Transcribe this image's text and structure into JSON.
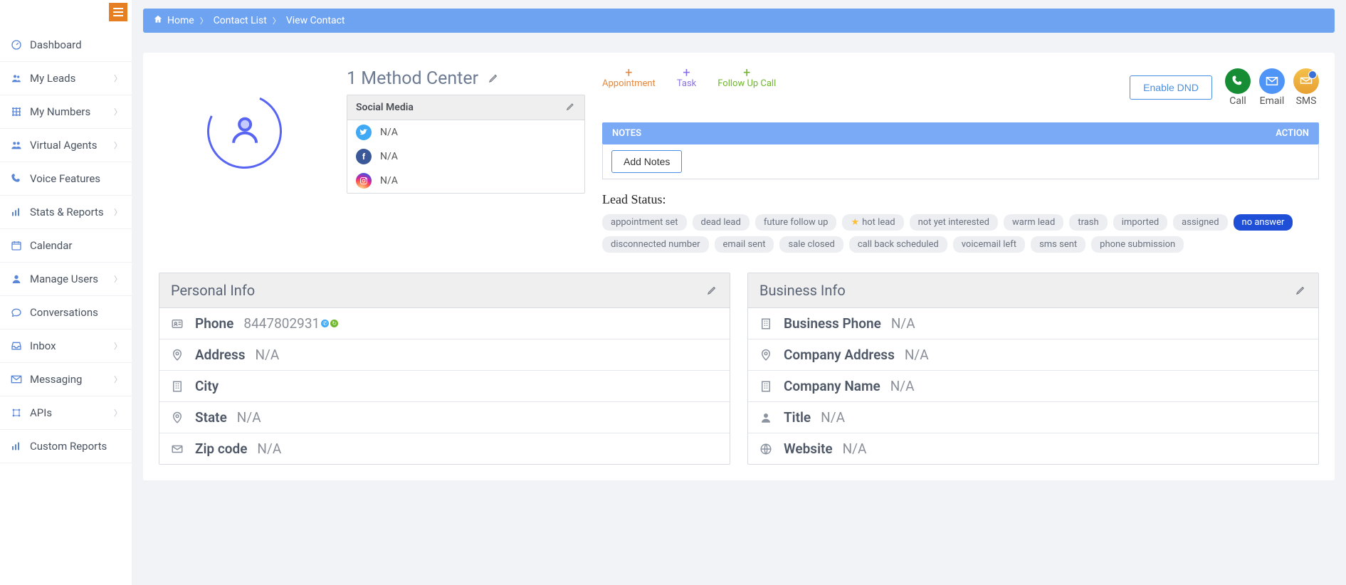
{
  "sidebar": {
    "items": [
      {
        "icon": "dashboard",
        "label": "Dashboard",
        "chevron": false
      },
      {
        "icon": "users",
        "label": "My Leads",
        "chevron": true
      },
      {
        "icon": "grid",
        "label": "My Numbers",
        "chevron": true
      },
      {
        "icon": "agents",
        "label": "Virtual Agents",
        "chevron": true
      },
      {
        "icon": "phone",
        "label": "Voice Features",
        "chevron": false
      },
      {
        "icon": "bars",
        "label": "Stats & Reports",
        "chevron": true
      },
      {
        "icon": "calendar",
        "label": "Calendar",
        "chevron": false
      },
      {
        "icon": "user",
        "label": "Manage Users",
        "chevron": true
      },
      {
        "icon": "chat",
        "label": "Conversations",
        "chevron": false
      },
      {
        "icon": "inbox",
        "label": "Inbox",
        "chevron": true
      },
      {
        "icon": "envelope",
        "label": "Messaging",
        "chevron": true
      },
      {
        "icon": "api",
        "label": "APIs",
        "chevron": true
      },
      {
        "icon": "bars",
        "label": "Custom Reports",
        "chevron": false
      }
    ]
  },
  "breadcrumb": {
    "home": "Home",
    "contact_list": "Contact List",
    "view_contact": "View Contact"
  },
  "contact": {
    "name": "1 Method Center"
  },
  "social_media": {
    "header": "Social Media",
    "twitter": "N/A",
    "facebook": "N/A",
    "instagram": "N/A"
  },
  "quick_actions": {
    "appointment": "Appointment",
    "task": "Task",
    "follow_up": "Follow Up Call"
  },
  "dnd_button": "Enable DND",
  "comm": {
    "call": "Call",
    "email": "Email",
    "sms": "SMS"
  },
  "notes_bar": {
    "notes": "NOTES",
    "action": "ACTION"
  },
  "add_notes": "Add Notes",
  "lead_status_label": "Lead Status:",
  "lead_status_tags": [
    {
      "label": "appointment set",
      "active": false,
      "star": false
    },
    {
      "label": "dead lead",
      "active": false,
      "star": false
    },
    {
      "label": "future follow up",
      "active": false,
      "star": false
    },
    {
      "label": "hot lead",
      "active": false,
      "star": true
    },
    {
      "label": "not yet interested",
      "active": false,
      "star": false
    },
    {
      "label": "warm lead",
      "active": false,
      "star": false
    },
    {
      "label": "trash",
      "active": false,
      "star": false
    },
    {
      "label": "imported",
      "active": false,
      "star": false
    },
    {
      "label": "assigned",
      "active": false,
      "star": false
    },
    {
      "label": "no answer",
      "active": true,
      "star": false
    },
    {
      "label": "disconnected number",
      "active": false,
      "star": false
    },
    {
      "label": "email sent",
      "active": false,
      "star": false
    },
    {
      "label": "sale closed",
      "active": false,
      "star": false
    },
    {
      "label": "call back scheduled",
      "active": false,
      "star": false
    },
    {
      "label": "voicemail left",
      "active": false,
      "star": false
    },
    {
      "label": "sms sent",
      "active": false,
      "star": false
    },
    {
      "label": "phone submission",
      "active": false,
      "star": false
    }
  ],
  "personal_info": {
    "header": "Personal Info",
    "rows": [
      {
        "icon": "id",
        "label": "Phone",
        "value": "8447802931",
        "phone_dots": true
      },
      {
        "icon": "pin",
        "label": "Address",
        "value": "N/A"
      },
      {
        "icon": "building",
        "label": "City",
        "value": ""
      },
      {
        "icon": "pin",
        "label": "State",
        "value": "N/A"
      },
      {
        "icon": "mail",
        "label": "Zip code",
        "value": "N/A"
      }
    ]
  },
  "business_info": {
    "header": "Business Info",
    "rows": [
      {
        "icon": "building",
        "label": "Business Phone",
        "value": "N/A"
      },
      {
        "icon": "pin",
        "label": "Company Address",
        "value": "N/A"
      },
      {
        "icon": "building",
        "label": "Company Name",
        "value": "N/A"
      },
      {
        "icon": "person",
        "label": "Title",
        "value": "N/A"
      },
      {
        "icon": "globe",
        "label": "Website",
        "value": "N/A"
      }
    ]
  }
}
